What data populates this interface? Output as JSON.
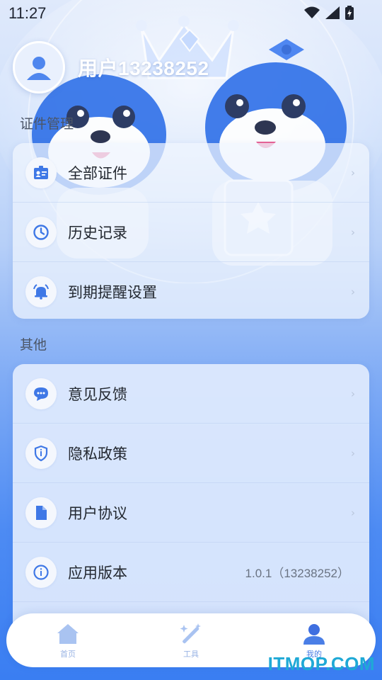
{
  "status_bar": {
    "time": "11:27",
    "icons": [
      "wifi-icon",
      "signal-icon",
      "battery-charging-icon"
    ]
  },
  "profile": {
    "username": "用户13238252",
    "avatar_icon": "user-avatar-icon"
  },
  "sections": {
    "cert_title": "证件管理",
    "other_title": "其他"
  },
  "cert_menu": [
    {
      "label": "全部证件",
      "icon": "id-card-icon"
    },
    {
      "label": "历史记录",
      "icon": "clock-icon"
    },
    {
      "label": "到期提醒设置",
      "icon": "bell-icon"
    }
  ],
  "other_menu": [
    {
      "label": "意见反馈",
      "icon": "chat-bubble-icon"
    },
    {
      "label": "隐私政策",
      "icon": "shield-icon"
    },
    {
      "label": "用户协议",
      "icon": "document-icon"
    },
    {
      "label": "应用版本",
      "icon": "info-icon",
      "value": "1.0.1（13238252）"
    }
  ],
  "bottom_nav": [
    {
      "label": "首页",
      "icon": "home-icon",
      "active": false
    },
    {
      "label": "工具",
      "icon": "magic-wand-icon",
      "active": false
    },
    {
      "label": "我的",
      "icon": "profile-icon",
      "active": true
    }
  ],
  "watermark": "ITMOP.COM",
  "colors": {
    "accent": "#4a7ee6",
    "icon_blue": "#3f78e6",
    "background_bottom": "#3a7ef2"
  }
}
